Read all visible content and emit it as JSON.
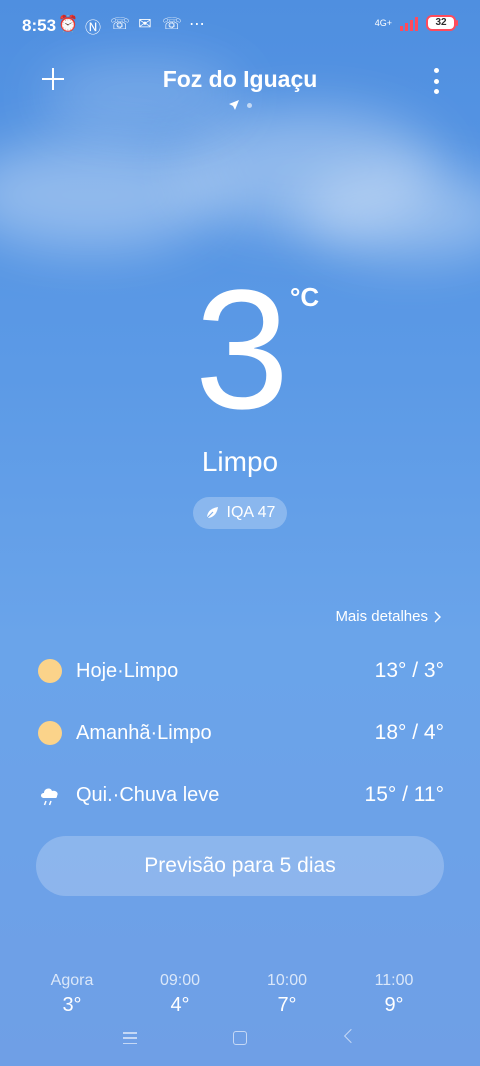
{
  "status_bar": {
    "time": "8:53",
    "network": "4G+",
    "battery": "32",
    "icons": [
      "alarm-icon",
      "nfc-icon",
      "whatsapp-icon",
      "chat-icon",
      "whatsapp-business-icon",
      "more-dots-icon"
    ]
  },
  "header": {
    "city": "Foz do Iguaçu"
  },
  "current": {
    "temperature": "3",
    "unit": "°C",
    "condition": "Limpo",
    "aqi": "IQA 47"
  },
  "forecast": {
    "more_details": "Mais detalhes",
    "days": [
      {
        "label": "Hoje·Limpo",
        "temps": "13° / 3°",
        "icon": "sun-icon"
      },
      {
        "label": "Amanhã·Limpo",
        "temps": "18° / 4°",
        "icon": "sun-icon"
      },
      {
        "label": "Qui.·Chuva leve",
        "temps": "15° / 11°",
        "icon": "light-rain-icon"
      }
    ],
    "five_day_button": "Previsão para 5 dias"
  },
  "hourly": [
    {
      "time": "Agora",
      "temp": "3°"
    },
    {
      "time": "09:00",
      "temp": "4°"
    },
    {
      "time": "10:00",
      "temp": "7°"
    },
    {
      "time": "11:00",
      "temp": "9°"
    }
  ],
  "colors": {
    "background_top": "#4f8fe0",
    "background_bottom": "#6f9fe6",
    "sun": "#fbd38a",
    "battery_accent": "#ff4b5c"
  }
}
